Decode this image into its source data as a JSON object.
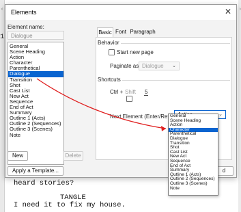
{
  "document": {
    "fragment_top": "11",
    "lines": [
      "heard stories?",
      "TANGLE",
      "I need it to fix my house."
    ]
  },
  "dialog": {
    "title": "Elements",
    "element_name_label": "Element name:",
    "element_name_value": "Dialogue",
    "elements": [
      "General",
      "Scene Heading",
      "Action",
      "Character",
      "Parenthetical",
      "Dialogue",
      "Transition",
      "Shot",
      "Cast List",
      "New Act",
      "Sequence",
      "End of Act",
      "Summary",
      "Outline 1 (Acts)",
      "Outline 2 (Sequences)",
      "Outline 3 (Scenes)",
      "Note"
    ],
    "selected_element": "Dialogue",
    "new_button": "New",
    "delete_button": "Delete",
    "apply_template_button": "Apply a Template...",
    "ok_fragment": "d",
    "tabs": [
      "Basic",
      "Font",
      "Paragraph"
    ],
    "active_tab": "Basic",
    "behavior": {
      "group_label": "Behavior",
      "start_new_page": "Start new page",
      "paginate_as_label": "Paginate as:",
      "paginate_as_value": "Dialogue"
    },
    "shortcuts": {
      "group_label": "Shortcuts",
      "ctrl_label": "Ctrl +",
      "shift_label": "Shift",
      "key": "5"
    },
    "next_element": {
      "label": "Next Element (Enter/Return):",
      "value": "Action",
      "options": [
        "General",
        "Scene Heading",
        "Action",
        "Character",
        "Parenthetical",
        "Dialogue",
        "Transition",
        "Shot",
        "Cast List",
        "New Act",
        "Sequence",
        "End of Act",
        "Summary",
        "Outline 1 (Acts)",
        "Outline 2 (Sequences)",
        "Outline 3 (Scenes)",
        "Note"
      ],
      "highlighted_option": "Character"
    }
  },
  "annotation": {
    "arrow_color": "#e02020"
  },
  "colors": {
    "selection": "#0a64d0"
  }
}
